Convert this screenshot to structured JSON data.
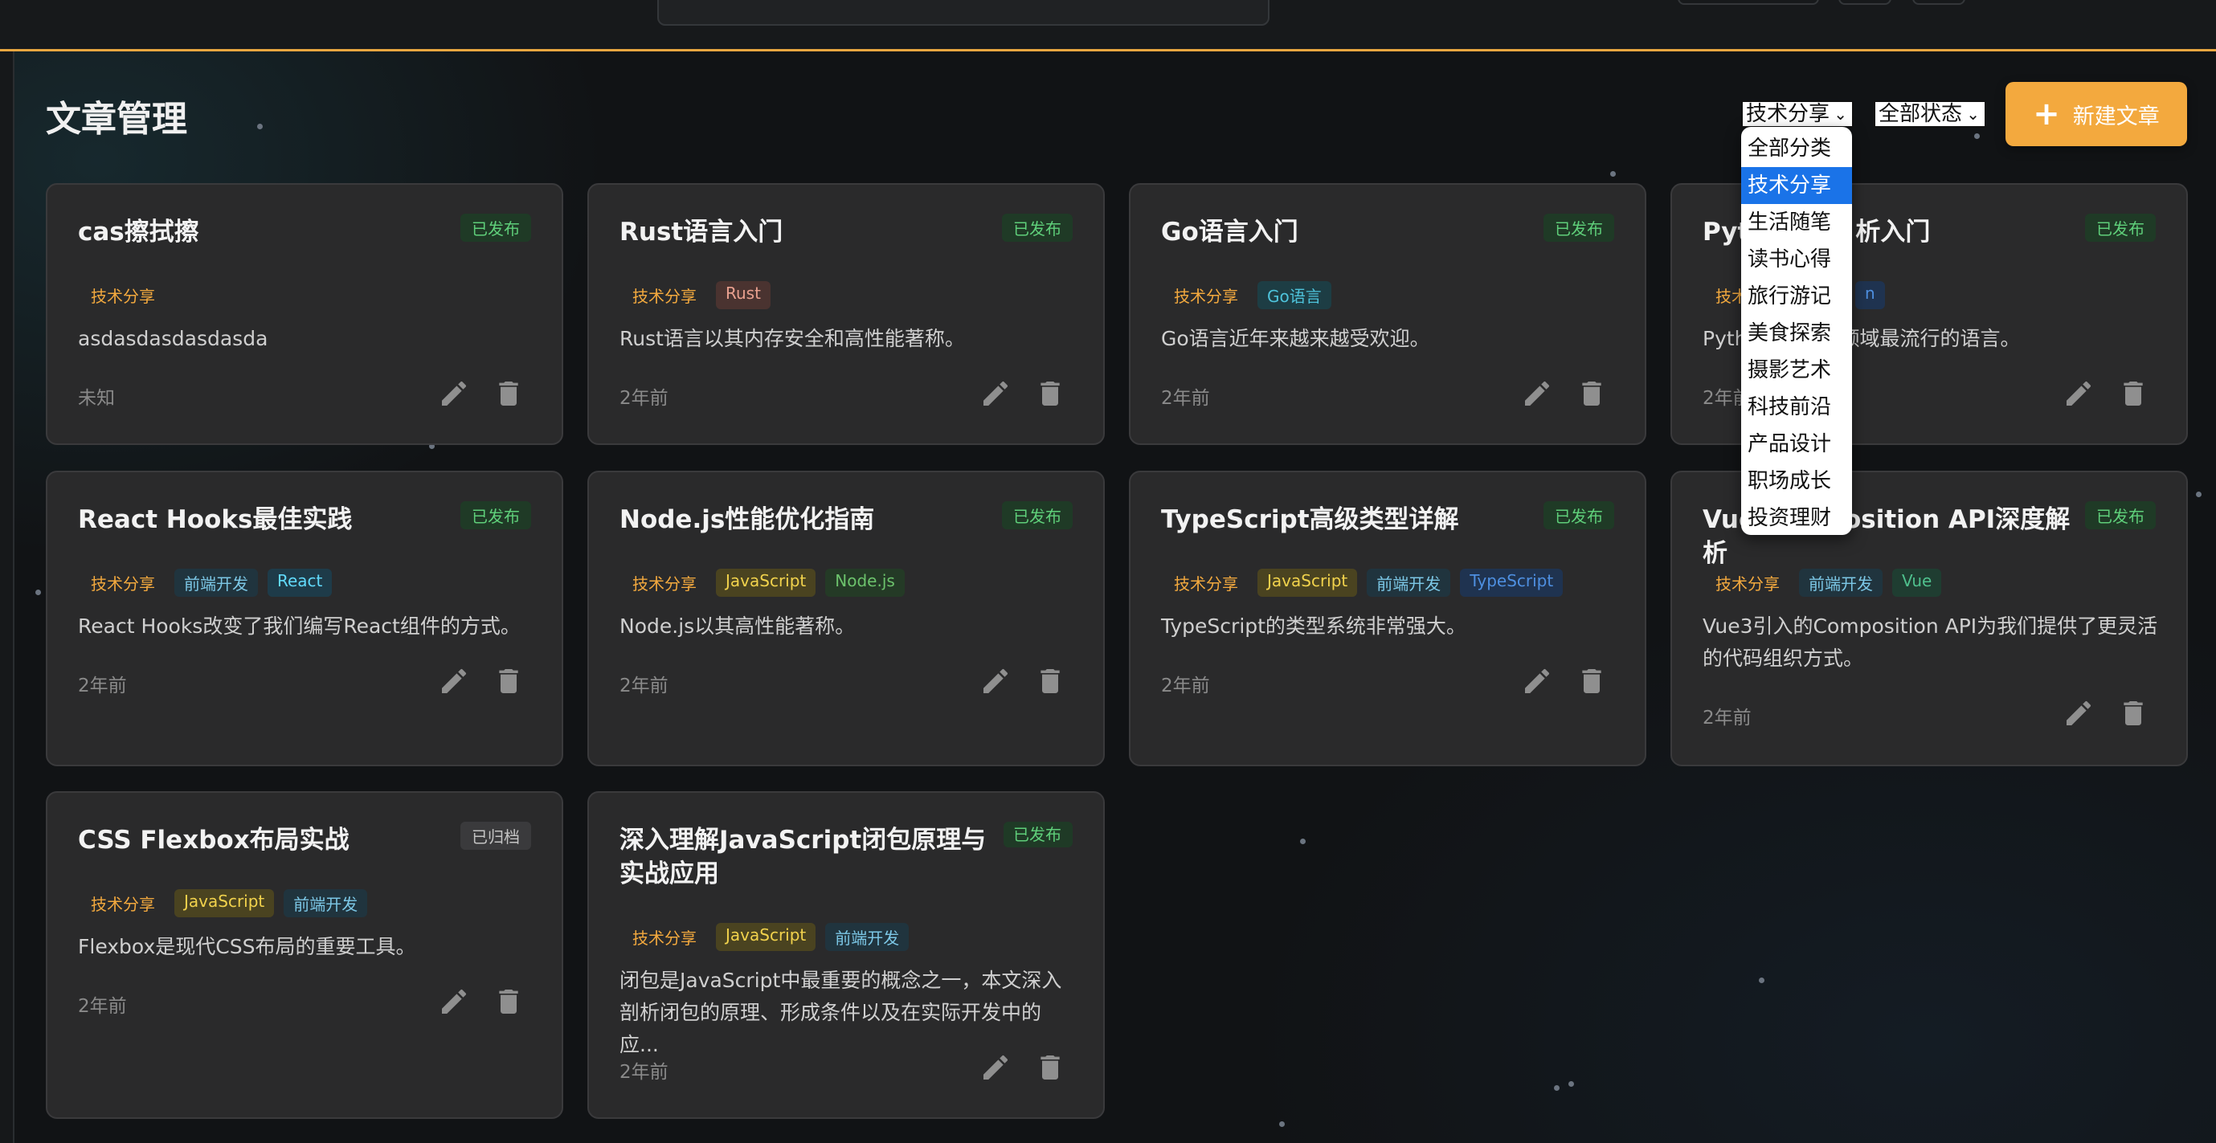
{
  "page": {
    "title": "文章管理",
    "new_button_label": "新建文章"
  },
  "filters": {
    "category_selected": "技术分享",
    "status_selected": "全部状态",
    "category_options": [
      "全部分类",
      "技术分享",
      "生活随笔",
      "读书心得",
      "旅行游记",
      "美食探索",
      "摄影艺术",
      "科技前沿",
      "产品设计",
      "职场成长",
      "投资理财"
    ]
  },
  "colors": {
    "accent": "#f3a93e",
    "published": "#5fcf7a",
    "selected_option": "#1a73e8"
  },
  "icons": {
    "edit": "pencil-icon",
    "delete": "trash-icon",
    "new": "plus-icon"
  },
  "articles": [
    {
      "title": "cas擦拭擦",
      "status": "已发布",
      "category": "技术分享",
      "tags": [],
      "desc": "asdasdasdasdasda",
      "time": "未知"
    },
    {
      "title": "Rust语言入门",
      "status": "已发布",
      "category": "技术分享",
      "tags": [
        "Rust"
      ],
      "desc": "Rust语言以其内存安全和高性能著称。",
      "time": "2年前"
    },
    {
      "title": "Go语言入门",
      "status": "已发布",
      "category": "技术分享",
      "tags": [
        "Go语言"
      ],
      "desc": "Go语言近年来越来越受欢迎。",
      "time": "2年前"
    },
    {
      "title": "Pyth",
      "title_end": "析入门",
      "status": "已发布",
      "category": "技术分享",
      "tags": [
        "n"
      ],
      "desc": "Pyth",
      "desc_end": "析领域最流行的语言。",
      "time": "2年前"
    },
    {
      "title": "React Hooks最佳实践",
      "status": "已发布",
      "category": "技术分享",
      "tags": [
        "前端开发",
        "React"
      ],
      "desc": "React Hooks改变了我们编写React组件的方式。",
      "time": "2年前"
    },
    {
      "title": "Node.js性能优化指南",
      "status": "已发布",
      "category": "技术分享",
      "tags": [
        "JavaScript",
        "Node.js"
      ],
      "desc": "Node.js以其高性能著称。",
      "time": "2年前"
    },
    {
      "title": "TypeScript高级类型详解",
      "status": "已发布",
      "category": "技术分享",
      "tags": [
        "JavaScript",
        "前端开发",
        "TypeScript"
      ],
      "desc": "TypeScript的类型系统非常强大。",
      "time": "2年前"
    },
    {
      "title": "Vue",
      "title_end": "osition API深度解析",
      "status": "已发布",
      "category": "技术分享",
      "tags": [
        "前端开发",
        "Vue"
      ],
      "desc": "Vue3引入的Composition API为我们提供了更灵活的代码组织方式。",
      "time": "2年前"
    },
    {
      "title": "CSS Flexbox布局实战",
      "status": "已归档",
      "category": "技术分享",
      "tags": [
        "JavaScript",
        "前端开发"
      ],
      "desc": "Flexbox是现代CSS布局的重要工具。",
      "time": "2年前"
    },
    {
      "title": "深入理解JavaScript闭包原理与实战应用",
      "status": "已发布",
      "category": "技术分享",
      "tags": [
        "JavaScript",
        "前端开发"
      ],
      "desc": "闭包是JavaScript中最重要的概念之一，本文深入剖析闭包的原理、形成条件以及在实际开发中的应...",
      "time": "2年前"
    }
  ]
}
